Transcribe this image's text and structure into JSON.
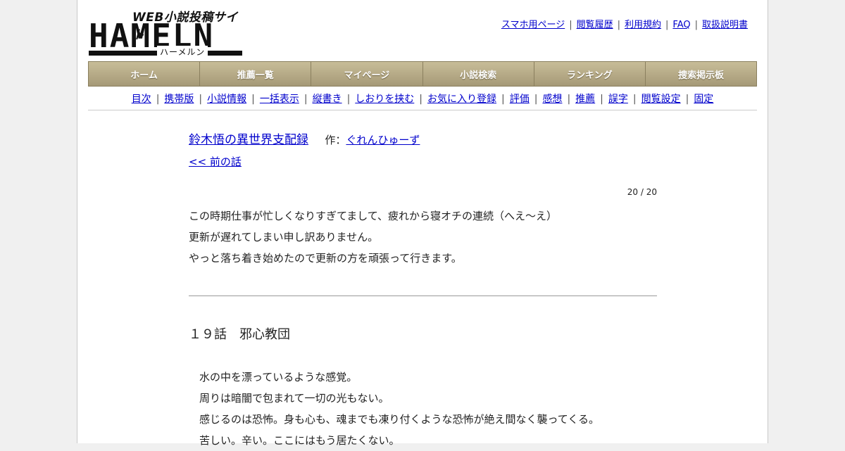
{
  "logo": {
    "tagline": "WEB小説投稿サイト",
    "name": "HAMELN",
    "kana": "ハーメルン"
  },
  "top_links": [
    "スマホ用ページ",
    "閲覧履歴",
    "利用規約",
    "FAQ",
    "取扱説明書"
  ],
  "main_nav": [
    "ホーム",
    "推薦一覧",
    "マイページ",
    "小説検索",
    "ランキング",
    "捜索掲示板"
  ],
  "sub_nav": [
    "目次",
    "携帯版",
    "小説情報",
    "一括表示",
    "縦書き",
    "しおりを挟む",
    "お気に入り登録",
    "評価",
    "感想",
    "推薦",
    "誤字",
    "閲覧設定",
    "固定"
  ],
  "novel": {
    "title": "鈴木悟の異世界支配録",
    "author_prefix": "作：",
    "author": "ぐれんひゅーず",
    "prev_link": "<< 前の話",
    "page_info": "20 / 20",
    "preface": [
      "この時期仕事が忙しくなりすぎてまして、疲れから寝オチの連続（へえ～え）",
      "更新が遅れてしまい申し訳ありません。",
      "やっと落ち着き始めたので更新の方を頑張って行きます。"
    ],
    "chapter_title": "１９話　邪心教団",
    "body": [
      "水の中を漂っているような感覚。",
      "周りは暗闇で包まれて一切の光もない。",
      "感じるのは恐怖。身も心も、魂までも凍り付くような恐怖が絶え間なく襲ってくる。",
      "苦しい。辛い。ここにはもう居たくない。"
    ]
  }
}
